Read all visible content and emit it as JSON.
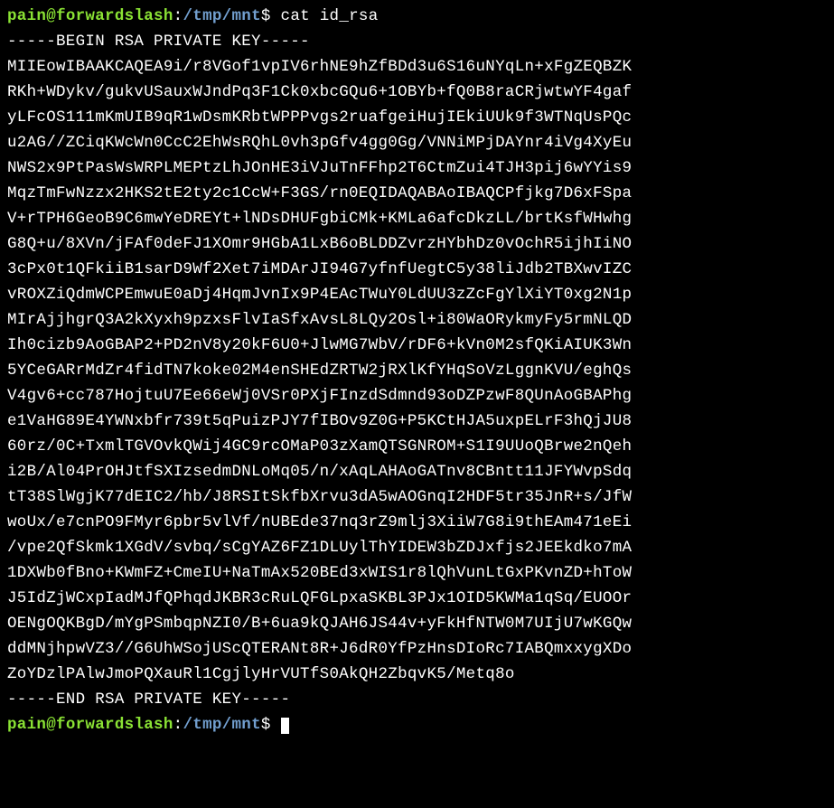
{
  "prompt1": {
    "user": "pain",
    "at": "@",
    "host": "forwardslash",
    "colon": ":",
    "path": "/tmp/mnt",
    "dollar": "$",
    "command": "cat id_rsa"
  },
  "output": {
    "begin": "-----BEGIN RSA PRIVATE KEY-----",
    "lines": [
      "MIIEowIBAAKCAQEA9i/r8VGof1vpIV6rhNE9hZfBDd3u6S16uNYqLn+xFgZEQBZK",
      "RKh+WDykv/gukvUSauxWJndPq3F1Ck0xbcGQu6+1OBYb+fQ0B8raCRjwtwYF4gaf",
      "yLFcOS111mKmUIB9qR1wDsmKRbtWPPPvgs2ruafgeiHujIEkiUUk9f3WTNqUsPQc",
      "u2AG//ZCiqKWcWn0CcC2EhWsRQhL0vh3pGfv4gg0Gg/VNNiMPjDAYnr4iVg4XyEu",
      "NWS2x9PtPasWsWRPLMEPtzLhJOnHE3iVJuTnFFhp2T6CtmZui4TJH3pij6wYYis9",
      "MqzTmFwNzzx2HKS2tE2ty2c1CcW+F3GS/rn0EQIDAQABAoIBAQCPfjkg7D6xFSpa",
      "V+rTPH6GeoB9C6mwYeDREYt+lNDsDHUFgbiCMk+KMLa6afcDkzLL/brtKsfWHwhg",
      "G8Q+u/8XVn/jFAf0deFJ1XOmr9HGbA1LxB6oBLDDZvrzHYbhDz0vOchR5ijhIiNO",
      "3cPx0t1QFkiiB1sarD9Wf2Xet7iMDArJI94G7yfnfUegtC5y38liJdb2TBXwvIZC",
      "vROXZiQdmWCPEmwuE0aDj4HqmJvnIx9P4EAcTWuY0LdUU3zZcFgYlXiYT0xg2N1p",
      "MIrAjjhgrQ3A2kXyxh9pzxsFlvIaSfxAvsL8LQy2Osl+i80WaORykmyFy5rmNLQD",
      "Ih0cizb9AoGBAP2+PD2nV8y20kF6U0+JlwMG7WbV/rDF6+kVn0M2sfQKiAIUK3Wn",
      "5YCeGARrMdZr4fidTN7koke02M4enSHEdZRTW2jRXlKfYHqSoVzLggnKVU/eghQs",
      "V4gv6+cc787HojtuU7Ee66eWj0VSr0PXjFInzdSdmnd93oDZPzwF8QUnAoGBAPhg",
      "e1VaHG89E4YWNxbfr739t5qPuizPJY7fIBOv9Z0G+P5KCtHJA5uxpELrF3hQjJU8",
      "60rz/0C+TxmlTGVOvkQWij4GC9rcOMaP03zXamQTSGNROM+S1I9UUoQBrwe2nQeh",
      "i2B/Al04PrOHJtfSXIzsedmDNLoMq05/n/xAqLAHAoGATnv8CBntt11JFYWvpSdq",
      "tT38SlWgjK77dEIC2/hb/J8RSItSkfbXrvu3dA5wAOGnqI2HDF5tr35JnR+s/JfW",
      "woUx/e7cnPO9FMyr6pbr5vlVf/nUBEde37nq3rZ9mlj3XiiW7G8i9thEAm471eEi",
      "/vpe2QfSkmk1XGdV/svbq/sCgYAZ6FZ1DLUylThYIDEW3bZDJxfjs2JEEkdko7mA",
      "1DXWb0fBno+KWmFZ+CmeIU+NaTmAx520BEd3xWIS1r8lQhVunLtGxPKvnZD+hToW",
      "J5IdZjWCxpIadMJfQPhqdJKBR3cRuLQFGLpxaSKBL3PJx1OID5KWMa1qSq/EUOOr",
      "OENgOQKBgD/mYgPSmbqpNZI0/B+6ua9kQJAH6JS44v+yFkHfNTW0M7UIjU7wKGQw",
      "ddMNjhpwVZ3//G6UhWSojUScQTERANt8R+J6dR0YfPzHnsDIoRc7IABQmxxygXDo",
      "ZoYDzlPAlwJmoPQXauRl1CgjlyHrVUTfS0AkQH2ZbqvK5/Metq8o"
    ],
    "end": "-----END RSA PRIVATE KEY-----"
  },
  "prompt2": {
    "user": "pain",
    "at": "@",
    "host": "forwardslash",
    "colon": ":",
    "path": "/tmp/mnt",
    "dollar": "$"
  }
}
